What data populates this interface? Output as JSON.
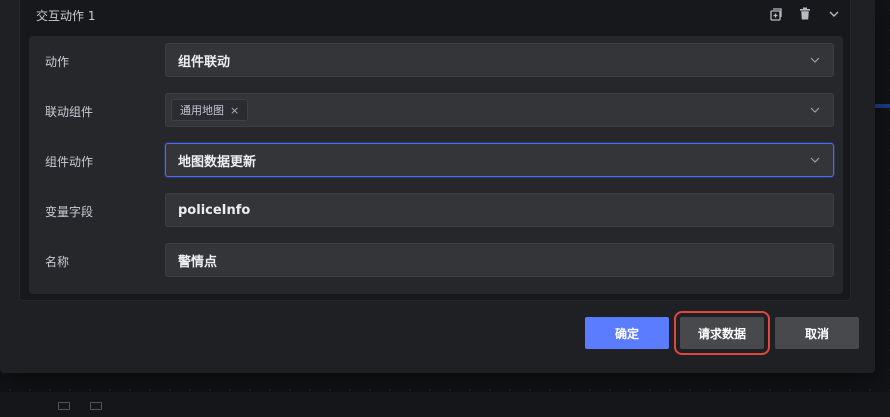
{
  "modal": {
    "title": "交互动作 1",
    "header_icons": [
      "add-copy-icon",
      "trash-icon",
      "chevron-down-icon"
    ],
    "rows": [
      {
        "label": "动作",
        "value": "组件联动",
        "type": "select"
      },
      {
        "label": "联动组件",
        "tag": "通用地图",
        "tag_remove": "×",
        "type": "multiselect"
      },
      {
        "label": "组件动作",
        "value": "地图数据更新",
        "type": "select",
        "focused": true
      },
      {
        "label": "变量字段",
        "value": "policeInfo",
        "type": "input"
      },
      {
        "label": "名称",
        "value": "警情点",
        "type": "input"
      }
    ],
    "buttons": {
      "confirm": "确定",
      "request_data": "请求数据",
      "cancel": "取消"
    }
  },
  "colors": {
    "primary": "#5b7cff",
    "focus_border": "#4c68ff",
    "highlight": "#e0473f"
  }
}
